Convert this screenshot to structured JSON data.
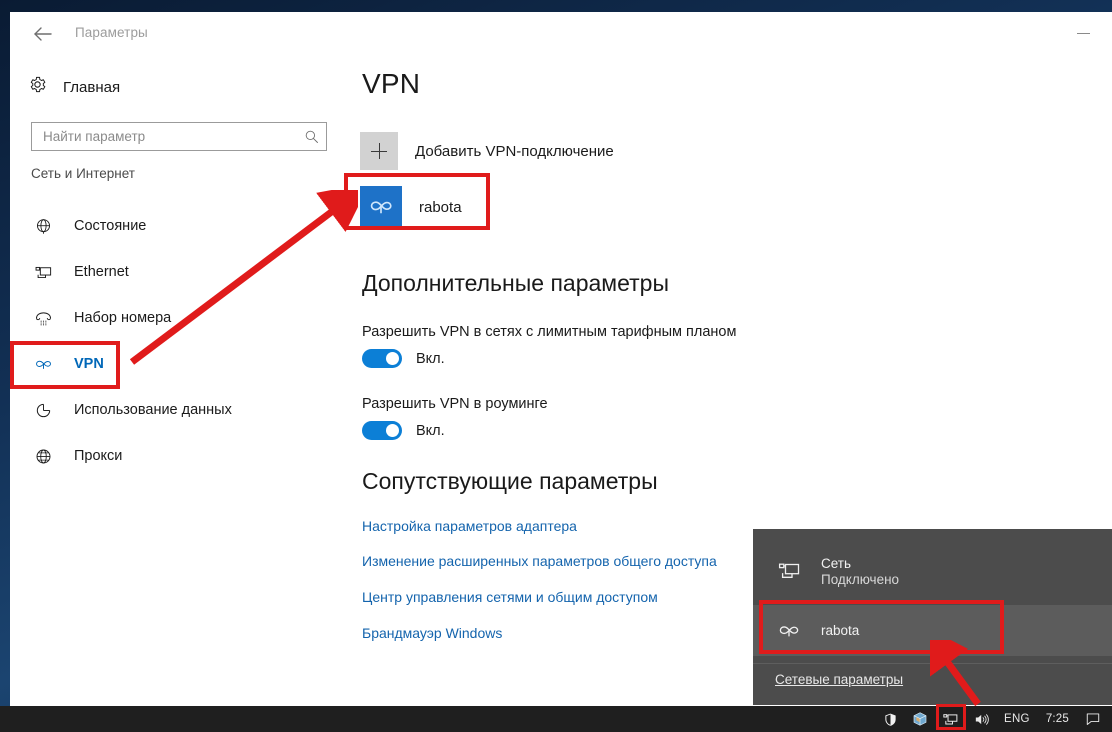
{
  "window": {
    "title": "Параметры",
    "back_icon": "back-arrow-icon",
    "minimize_icon": "minimize-icon"
  },
  "sidebar": {
    "home": {
      "label": "Главная",
      "icon": "gear-icon"
    },
    "search": {
      "placeholder": "Найти параметр",
      "value": "",
      "icon": "search-icon"
    },
    "section_label": "Сеть и Интернет",
    "items": [
      {
        "label": "Состояние",
        "icon": "globe-status-icon",
        "selected": false
      },
      {
        "label": "Ethernet",
        "icon": "ethernet-icon",
        "selected": false
      },
      {
        "label": "Набор номера",
        "icon": "dial-up-icon",
        "selected": false
      },
      {
        "label": "VPN",
        "icon": "vpn-icon",
        "selected": true
      },
      {
        "label": "Использование данных",
        "icon": "data-usage-icon",
        "selected": false
      },
      {
        "label": "Прокси",
        "icon": "proxy-globe-icon",
        "selected": false
      }
    ]
  },
  "content": {
    "page_title": "VPN",
    "add_connection": {
      "label": "Добавить VPN-подключение",
      "icon": "plus-icon"
    },
    "connections": [
      {
        "name": "rabota",
        "icon": "vpn-connection-icon"
      }
    ],
    "advanced": {
      "heading": "Дополнительные параметры",
      "settings": [
        {
          "label": "Разрешить VPN в сетях с лимитным тарифным планом",
          "state": "Вкл.",
          "on": true
        },
        {
          "label": "Разрешить VPN в роуминге",
          "state": "Вкл.",
          "on": true
        }
      ]
    },
    "related": {
      "heading": "Сопутствующие параметры",
      "links": [
        "Настройка параметров адаптера",
        "Изменение расширенных параметров общего доступа",
        "Центр управления сетями и общим доступом",
        "Брандмауэр Windows"
      ]
    }
  },
  "network_flyout": {
    "network": {
      "title": "Сеть",
      "status": "Подключено",
      "icon": "ethernet-icon"
    },
    "vpn": {
      "name": "rabota",
      "icon": "vpn-connection-icon"
    },
    "settings_link": "Сетевые параметры"
  },
  "taskbar": {
    "tray": [
      {
        "name": "defender-shield-icon",
        "label": ""
      },
      {
        "name": "app-cube-icon",
        "label": ""
      },
      {
        "name": "network-icon",
        "label": ""
      },
      {
        "name": "volume-icon",
        "label": ""
      }
    ],
    "language": "ENG",
    "clock": "7:25",
    "action_center_icon": "action-center-icon"
  },
  "colors": {
    "accent": "#0078d7",
    "link": "#1464ad",
    "annotation": "#e01b1b",
    "tile_blue": "#1e72c8",
    "flyout_bg": "#4c4c4c",
    "taskbar_bg": "#1f1f1f"
  }
}
